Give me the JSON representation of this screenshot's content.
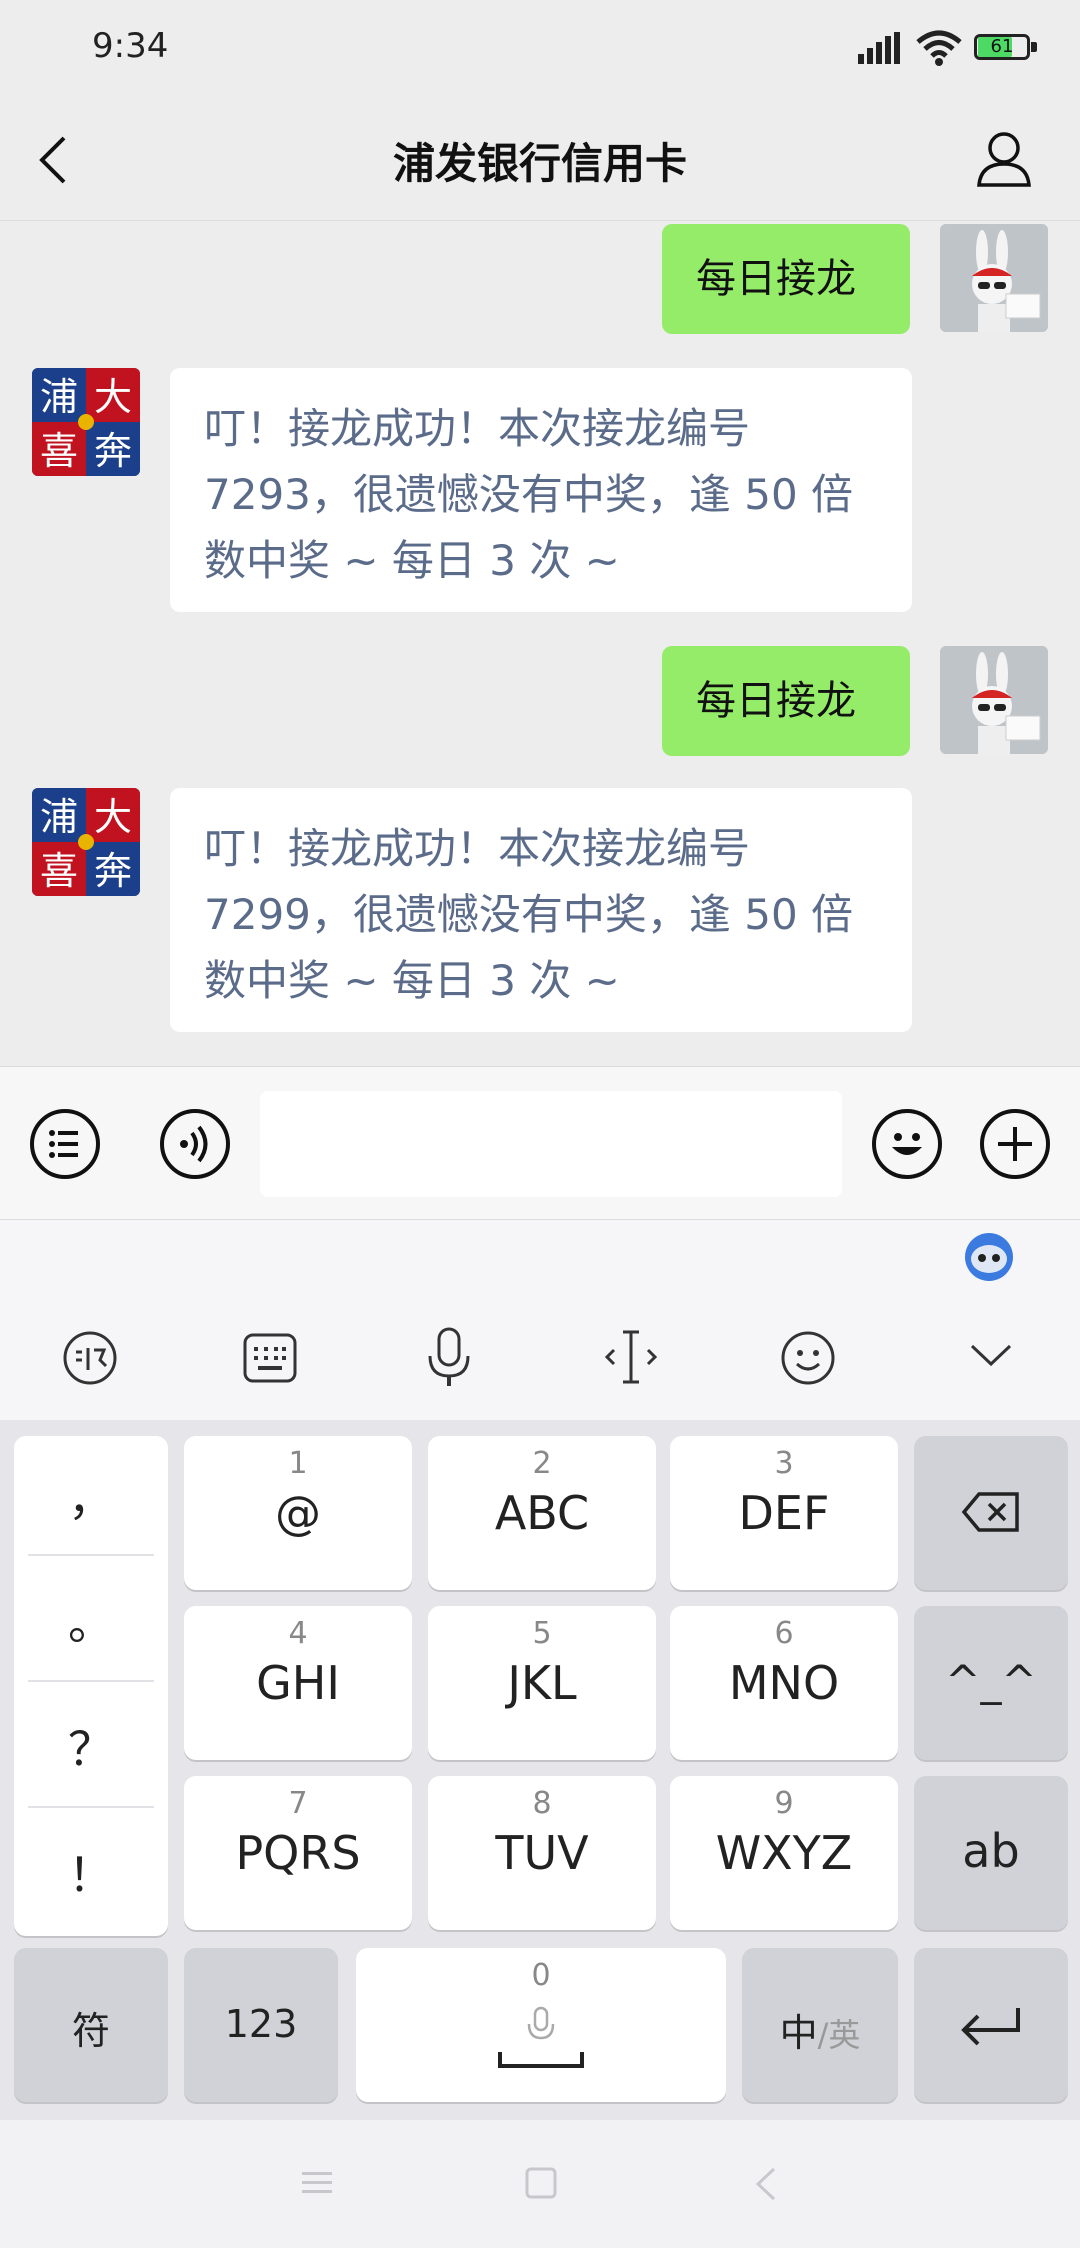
{
  "status_bar": {
    "time": "9:34",
    "battery": "61"
  },
  "header": {
    "title": "浦发银行信用卡"
  },
  "messages": [
    {
      "side": "right",
      "text": "每日接龙"
    },
    {
      "side": "left",
      "lines": [
        "叮！接龙成功！本次接龙编号",
        "7293，很遗憾没有中奖，逢 50 倍",
        "数中奖 ~ 每日 3 次 ~"
      ]
    },
    {
      "side": "right",
      "text": "每日接龙"
    },
    {
      "side": "left",
      "lines": [
        "叮！接龙成功！本次接龙编号",
        "7299，很遗憾没有中奖，逢 50 倍",
        "数中奖 ~ 每日 3 次 ~"
      ]
    }
  ],
  "avatar_left_chars": [
    "浦",
    "大",
    "喜",
    "奔"
  ],
  "input": {
    "value": ""
  },
  "keyboard": {
    "punct": [
      "，",
      "。",
      "？",
      "！"
    ],
    "keys": [
      {
        "num": "1",
        "letters": "@"
      },
      {
        "num": "2",
        "letters": "ABC"
      },
      {
        "num": "3",
        "letters": "DEF"
      },
      {
        "num": "4",
        "letters": "GHI"
      },
      {
        "num": "5",
        "letters": "JKL"
      },
      {
        "num": "6",
        "letters": "MNO"
      },
      {
        "num": "7",
        "letters": "PQRS"
      },
      {
        "num": "8",
        "letters": "TUV"
      },
      {
        "num": "9",
        "letters": "WXYZ"
      }
    ],
    "emoticon_key": "^_^",
    "ab_key": "ab",
    "symbol_key": "符",
    "numeric_key": "123",
    "space_num": "0",
    "lang_main": "中",
    "lang_alt": "/英"
  },
  "colors": {
    "outgoing_bubble": "#95ec69",
    "incoming_text": "#5b6b8a",
    "background": "#ededed"
  },
  "icons": [
    "back-icon",
    "person-icon",
    "list-icon",
    "voice-icon",
    "emoji-icon",
    "plus-icon",
    "assistant-icon",
    "handwriting-icon",
    "keyboard-icon",
    "mic-icon",
    "cursor-icon",
    "smiley-icon",
    "collapse-icon",
    "delete-icon",
    "enter-icon"
  ]
}
